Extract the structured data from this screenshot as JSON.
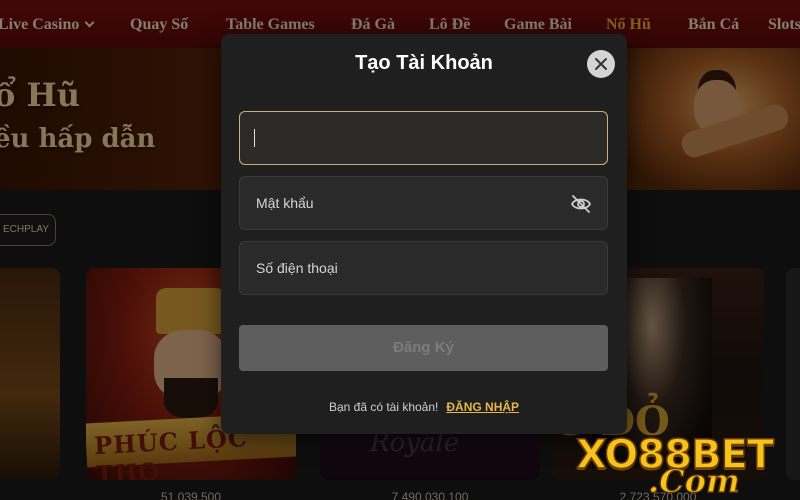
{
  "nav": {
    "items": [
      {
        "label": "Live Casino",
        "has_dropdown": true
      },
      {
        "label": "Quay Số"
      },
      {
        "label": "Table Games"
      },
      {
        "label": "Đá Gà"
      },
      {
        "label": "Lô Đề"
      },
      {
        "label": "Game Bài"
      },
      {
        "label": "Nổ Hũ",
        "active": true
      },
      {
        "label": "Bắn Cá"
      },
      {
        "label": "Slots"
      }
    ]
  },
  "banner": {
    "title": "ổ Hũ",
    "subtitle": "ều hấp dẫn"
  },
  "filter": {
    "chip_label": "ECHPLAY"
  },
  "cards": [
    {
      "title_text": "",
      "amount": ""
    },
    {
      "title_text": "PHÚC LỘC THỌ",
      "amount": "51.039.500"
    },
    {
      "title_text": "Royale",
      "amount": "7.490.030.100"
    },
    {
      "title_text": "G ĐỎ",
      "amount": "2.723.570.000"
    }
  ],
  "modal": {
    "title": "Tạo Tài Khoản",
    "username": {
      "value": "",
      "placeholder": ""
    },
    "password": {
      "value": "",
      "placeholder": "Mật khẩu"
    },
    "phone": {
      "value": "",
      "placeholder": "Số điện thoại"
    },
    "submit_label": "Đăng Ký",
    "footer_text": "Bạn đã có tài khoản!",
    "login_link": "ĐĂNG NHẬP"
  },
  "watermark": {
    "line1": "XO88BET",
    "line2": ".Com"
  },
  "icons": {
    "close": "close-icon",
    "password_toggle": "eye-off-icon",
    "nav_dropdown": "chevron-down-icon"
  },
  "colors": {
    "nav_bg": "#6b0d0d",
    "nav_active": "#f2b13a",
    "modal_bg": "#1f1f1f",
    "field_bg": "#2a2a2a",
    "field_focus_border": "#c9b17a",
    "submit_bg": "#5e5e5e",
    "link": "#e6b84a",
    "logo_gold": "#f6c21c"
  }
}
